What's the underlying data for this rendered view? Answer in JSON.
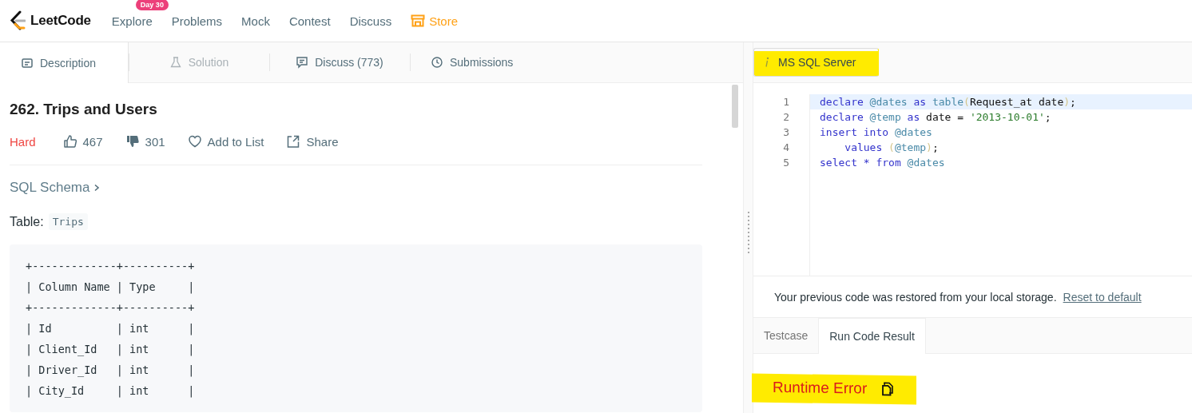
{
  "nav": {
    "logo": "LeetCode",
    "links": [
      {
        "label": "Explore",
        "badge": "Day 30",
        "kind": "plain"
      },
      {
        "label": "Problems",
        "kind": "plain"
      },
      {
        "label": "Mock",
        "kind": "plain"
      },
      {
        "label": "Contest",
        "kind": "plain"
      },
      {
        "label": "Discuss",
        "kind": "plain"
      },
      {
        "label": "Store",
        "kind": "store"
      }
    ]
  },
  "left_tabs": [
    {
      "label": "Description",
      "selected": true,
      "disabled": false
    },
    {
      "label": "Solution",
      "selected": false,
      "disabled": true
    },
    {
      "label": "Discuss (773)",
      "selected": false,
      "disabled": false
    },
    {
      "label": "Submissions",
      "selected": false,
      "disabled": false
    }
  ],
  "problem": {
    "title": "262. Trips and Users",
    "difficulty": "Hard",
    "likes": "467",
    "dislikes": "301",
    "add_to_list": "Add to List",
    "share": "Share",
    "schema_link": "SQL Schema",
    "table_label": "Table:",
    "table_name": "Trips",
    "schema_lines": [
      "+-------------+----------+",
      "| Column Name | Type     |",
      "+-------------+----------+",
      "| Id          | int      |",
      "| Client_Id   | int      |",
      "| Driver_Id   | int      |",
      "| City_Id     | int      |"
    ]
  },
  "editor": {
    "language": {
      "label": "MS SQL Server",
      "highlighted": true
    },
    "lines": [
      {
        "number": "1",
        "active": true,
        "tokens": [
          {
            "kind": "keyword",
            "text": "declare"
          },
          {
            "kind": "variable",
            "text": " @dates"
          },
          {
            "kind": "keyword",
            "text": " as"
          },
          {
            "kind": "variable",
            "text": " table"
          },
          {
            "kind": "paren",
            "text": "("
          },
          {
            "kind": "plain",
            "text": "Request_at date"
          },
          {
            "kind": "paren",
            "text": ")"
          },
          {
            "kind": "plain",
            "text": ";"
          }
        ]
      },
      {
        "number": "2",
        "active": false,
        "tokens": [
          {
            "kind": "keyword",
            "text": "declare"
          },
          {
            "kind": "variable",
            "text": " @temp"
          },
          {
            "kind": "keyword",
            "text": " as"
          },
          {
            "kind": "plain",
            "text": " date = "
          },
          {
            "kind": "string",
            "text": "'2013-10-01'"
          },
          {
            "kind": "plain",
            "text": ";"
          }
        ]
      },
      {
        "number": "3",
        "active": false,
        "tokens": [
          {
            "kind": "keyword",
            "text": "insert"
          },
          {
            "kind": "keyword",
            "text": " into"
          },
          {
            "kind": "variable",
            "text": " @dates"
          }
        ]
      },
      {
        "number": "4",
        "active": false,
        "tokens": [
          {
            "kind": "keyword",
            "text": "    values"
          },
          {
            "kind": "paren",
            "text": " ("
          },
          {
            "kind": "variable",
            "text": "@temp"
          },
          {
            "kind": "paren",
            "text": ")"
          },
          {
            "kind": "plain",
            "text": ";"
          }
        ]
      },
      {
        "number": "5",
        "active": false,
        "tokens": [
          {
            "kind": "keyword",
            "text": "select"
          },
          {
            "kind": "keyword",
            "text": " *"
          },
          {
            "kind": "keyword",
            "text": " from"
          },
          {
            "kind": "variable",
            "text": " @dates"
          }
        ]
      }
    ],
    "notice": "Your previous code was restored from your local storage.",
    "reset_link": "Reset to default"
  },
  "result_tabs": [
    {
      "label": "Testcase",
      "selected": false
    },
    {
      "label": "Run Code Result",
      "selected": true
    }
  ],
  "result": {
    "status": "Runtime Error",
    "highlighted": true
  }
}
